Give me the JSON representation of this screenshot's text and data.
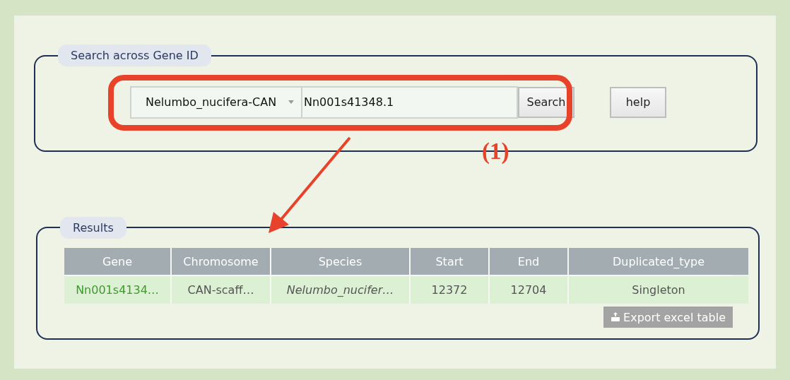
{
  "search_panel": {
    "legend": "Search across Gene ID",
    "species_select": {
      "value": "Nelumbo_nucifera-CAN"
    },
    "gene_field": {
      "value": "Nn001s41348.1"
    },
    "buttons": [
      "Search",
      "help"
    ]
  },
  "annotation": {
    "label": "(1)"
  },
  "results_panel": {
    "legend": "Results",
    "table": {
      "columns": [
        "Gene",
        "Chromosome",
        "Species",
        "Start",
        "End",
        "Duplicated_type"
      ],
      "rows": [
        {
          "cells": [
            {
              "text": "Nn001s4134…",
              "kind": "link"
            },
            {
              "text": "CAN-scaff…",
              "kind": "plain"
            },
            {
              "text": "Nelumbo_nucifer…",
              "kind": "italic"
            },
            {
              "text": "12372",
              "kind": "plain"
            },
            {
              "text": "12704",
              "kind": "plain"
            },
            {
              "text": "Singleton",
              "kind": "plain"
            }
          ]
        }
      ]
    },
    "export_button": "Export excel table"
  }
}
